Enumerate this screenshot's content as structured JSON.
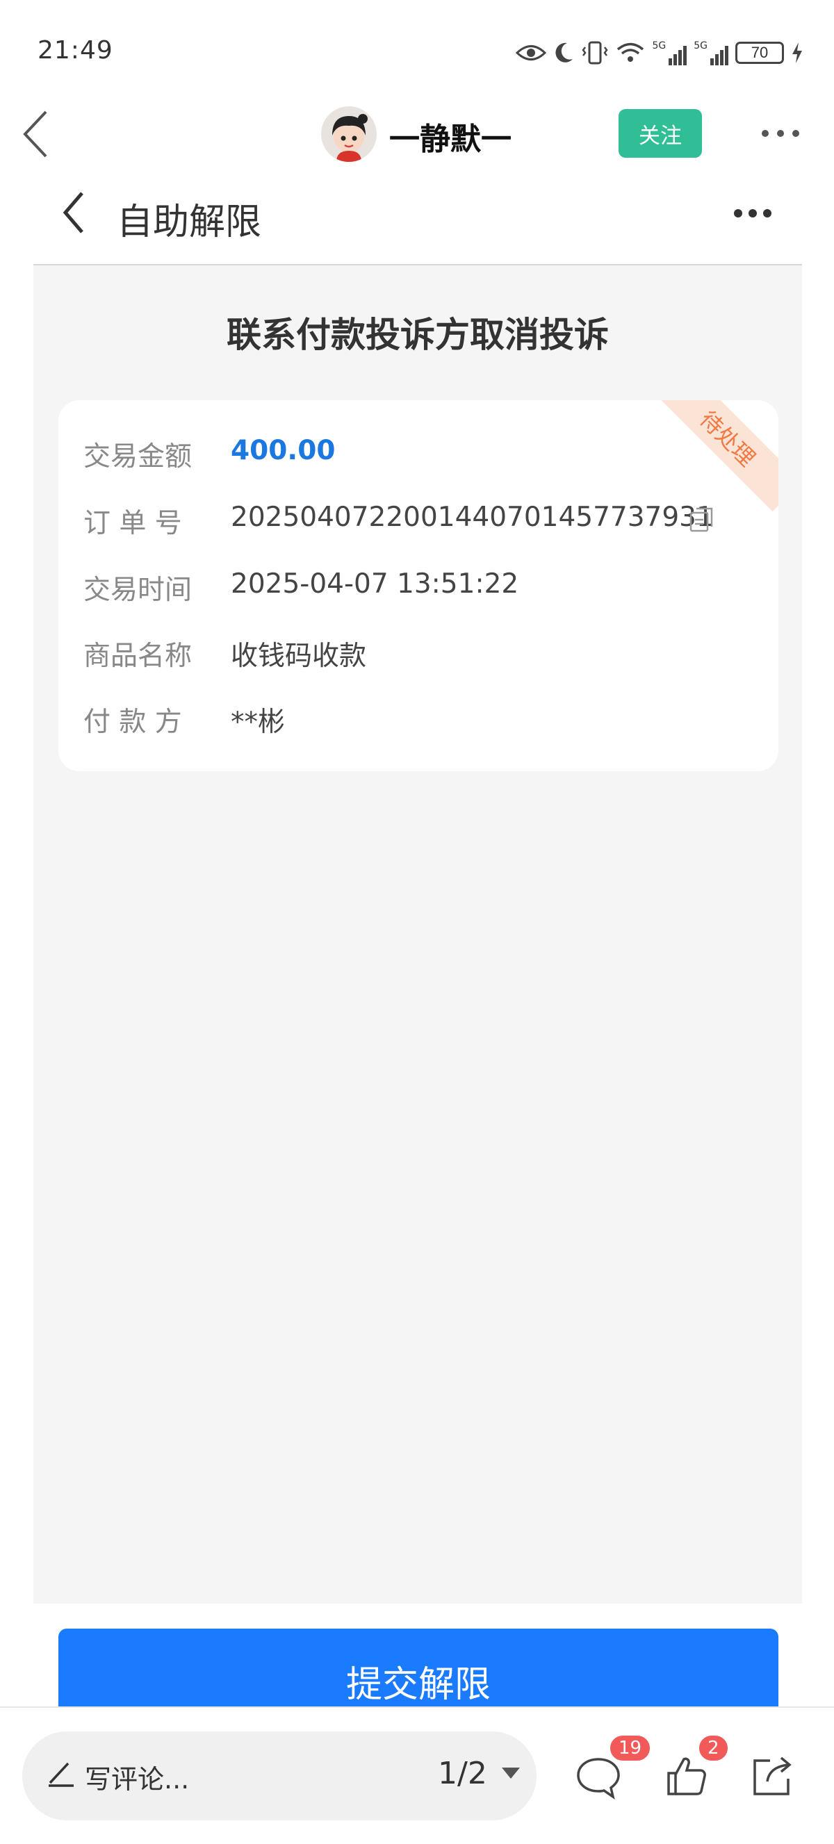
{
  "status_bar": {
    "time": "21:49",
    "battery": "70",
    "signal_1_label": "5G",
    "signal_2_label": "5G",
    "icons": [
      "eye-icon",
      "moon-icon",
      "vibrate-icon",
      "wifi-icon",
      "signal-icon",
      "signal-icon",
      "battery-icon",
      "charging-icon"
    ]
  },
  "post_header": {
    "author_name": "一静默一",
    "follow_label": "关注"
  },
  "inner_page": {
    "title": "自助解限",
    "heading": "联系付款投诉方取消投诉",
    "status_ribbon": "待处理",
    "rows": [
      {
        "label": "交易金额",
        "value": "400.00"
      },
      {
        "label": "订 单 号",
        "value": "2025040722001440701457737931"
      },
      {
        "label": "交易时间",
        "value": "2025-04-07 13:51:22"
      },
      {
        "label": "商品名称",
        "value": "收钱码收款"
      },
      {
        "label": "付 款 方",
        "value": "**彬"
      }
    ],
    "submit_label": "提交解限"
  },
  "bottom_bar": {
    "comment_placeholder": "写评论...",
    "page_indicator": "1/2",
    "comment_count": "19",
    "like_count": "2"
  },
  "colors": {
    "accent_blue": "#1a7bff",
    "amount_blue": "#1a78e0",
    "follow_green": "#2fbe96",
    "ribbon_orange": "#f07a43",
    "badge_red": "#f25a5a"
  }
}
